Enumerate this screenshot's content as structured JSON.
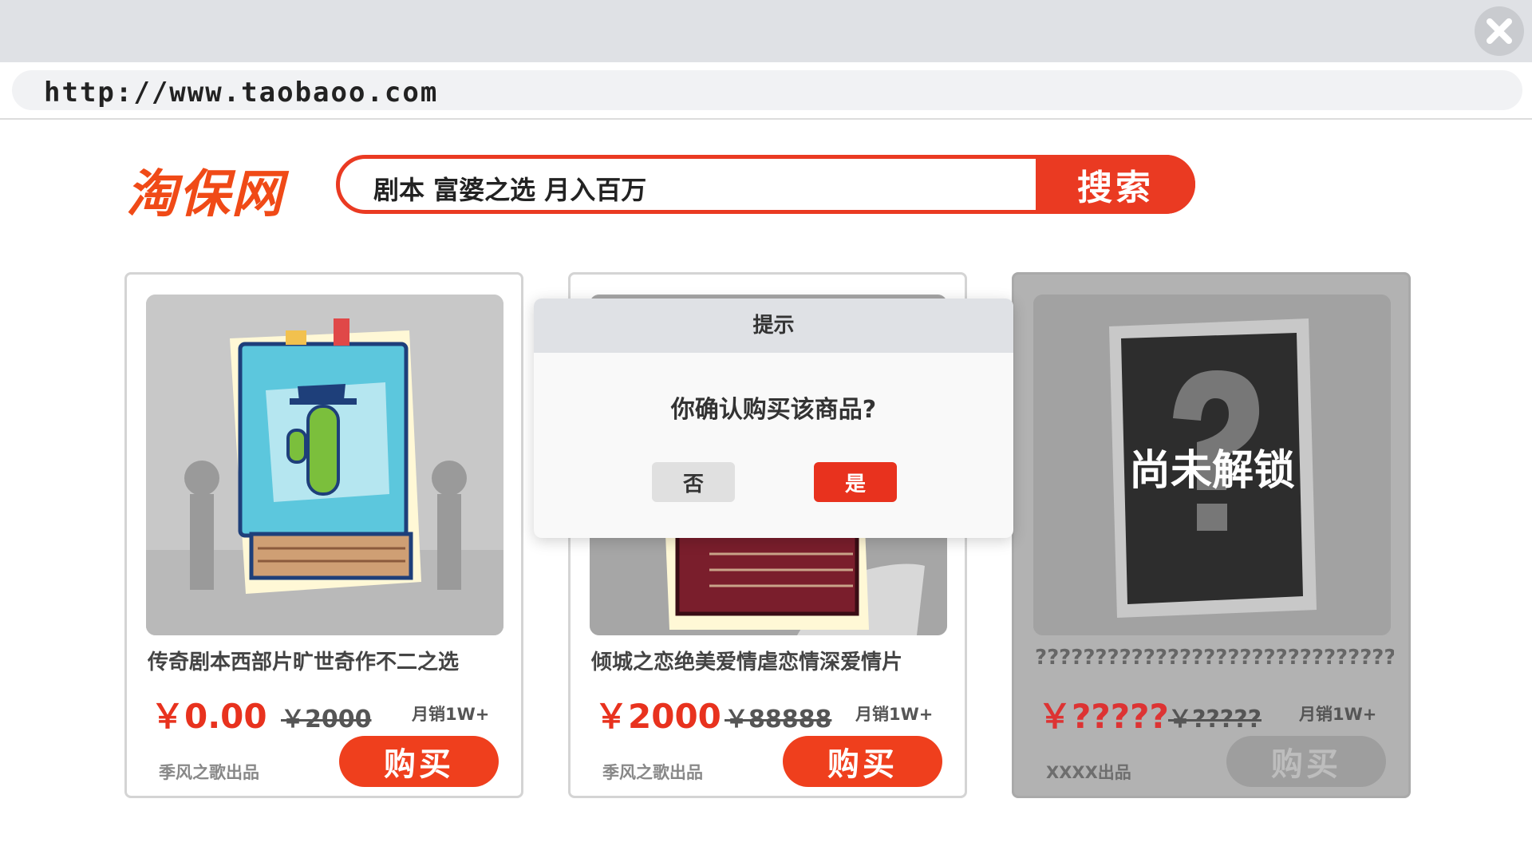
{
  "browser": {
    "url": "http://www.taobaoo.com",
    "close_icon": "close-icon"
  },
  "header": {
    "logo": "淘保网",
    "search_query": "剧本 富婆之选 月入百万",
    "search_button": "搜索"
  },
  "products": [
    {
      "title": "传奇剧本西部片旷世奇作不二之选",
      "price": "￥0.00",
      "original_price": "￥2000",
      "monthly_sales": "月销1W+",
      "maker": "季风之歌出品",
      "buy_label": "购买",
      "art": "western-script-book"
    },
    {
      "title": "倾城之恋绝美爱情虐恋情深爱情片",
      "price": "￥2000",
      "original_price": "￥88888",
      "monthly_sales": "月销1W+",
      "maker": "季风之歌出品",
      "buy_label": "购买",
      "art": "romance-script-book"
    },
    {
      "title": "????????????????????????????????????",
      "price": "￥?????",
      "original_price": "￥?????",
      "monthly_sales": "月销1W+",
      "maker": "XXXX出品",
      "buy_label": "购买",
      "lock_label": "尚未解锁",
      "art": "locked-mystery-book"
    }
  ],
  "dialog": {
    "title": "提示",
    "message": "你确认购买该商品?",
    "no_label": "否",
    "yes_label": "是"
  },
  "colors": {
    "accent": "#ea3a22",
    "logo": "#f04a17",
    "locked_card": "#b2b2b2"
  }
}
